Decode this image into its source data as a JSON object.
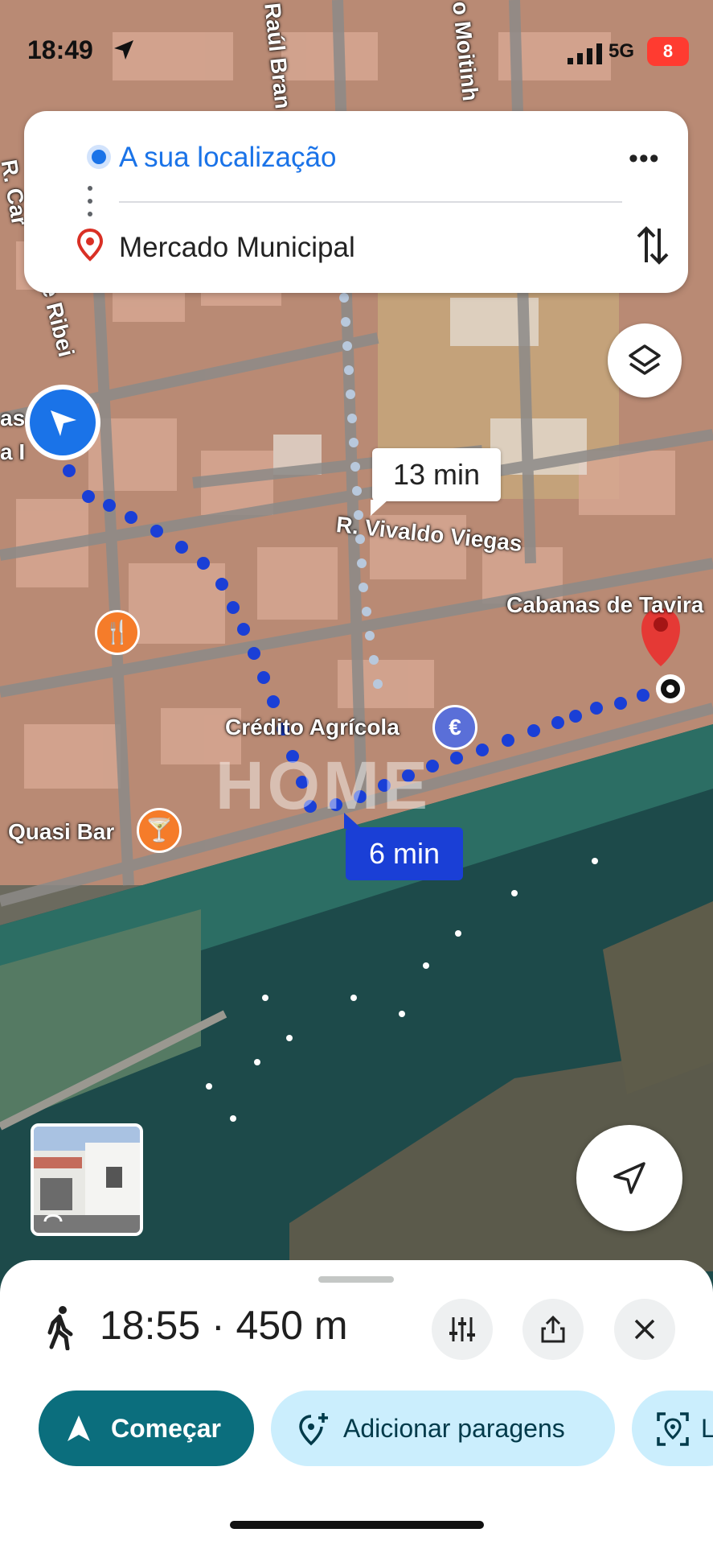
{
  "status_bar": {
    "time": "18:49",
    "network": "5G",
    "battery": "8"
  },
  "route": {
    "origin": "A sua localização",
    "destination": "Mercado Municipal"
  },
  "map": {
    "street_labels": [
      "Raúl Bran",
      "o Moitinh",
      "R. Car",
      "e Ribei",
      "as",
      "a I",
      "R. Vivaldo Viegas",
      "Cabanas de Tavira"
    ],
    "places": [
      "Crédito Agrícola",
      "Quasi Bar"
    ],
    "watermark": "HOME",
    "eta_chips": {
      "long": "13 min",
      "short": "6 min"
    },
    "colors": {
      "route": "#1a3fd6",
      "destination_pin": "#e53935",
      "restaurant": "#f57c2a",
      "bank": "#5a6fd8",
      "bar": "#f57c2a"
    }
  },
  "icons": {
    "layers": "layers-icon",
    "locate": "navigation-arrow-icon",
    "walk": "walking-icon"
  },
  "sheet": {
    "summary": "18:55 · 450 m",
    "start_label": "Começar",
    "add_stops_label": "Adicionar paragens",
    "live_view_label": "L"
  }
}
